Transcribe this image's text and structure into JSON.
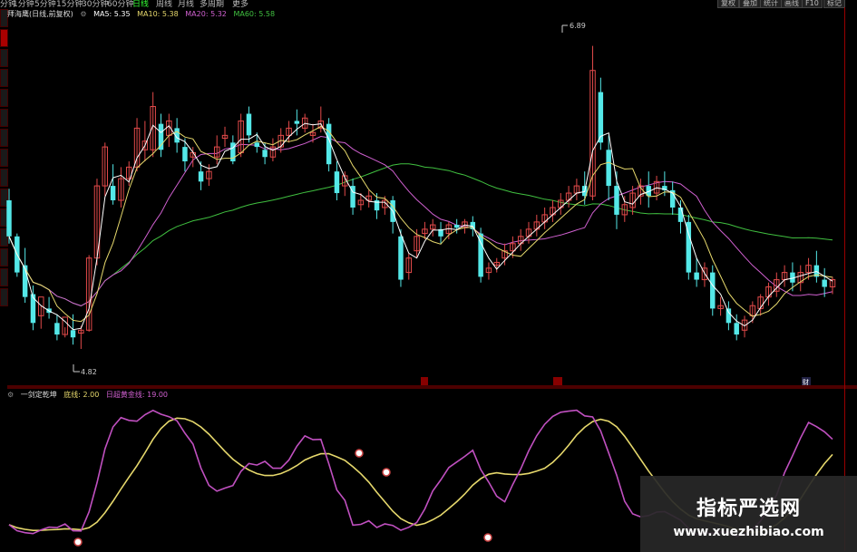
{
  "toolbar": {
    "periods": [
      "分钟",
      "1分钟",
      "5分钟",
      "15分钟",
      "30分钟",
      "60分钟",
      "日线",
      "周线",
      "月线",
      "多周期",
      "更多"
    ],
    "active_period": "日线",
    "right_buttons": [
      "复权",
      "叠加",
      "统计",
      "画线",
      "F10",
      "标记"
    ]
  },
  "main_legend": {
    "stock": "拜海鹰(日线,前复权)",
    "ma5": "MA5: 5.35",
    "ma10": "MA10: 5.38",
    "ma20": "MA20: 5.32",
    "ma60": "MA60: 5.58",
    "colors": {
      "ma5": "#ffffff",
      "ma10": "#e6d86c",
      "ma20": "#d060d0",
      "ma60": "#40c040"
    }
  },
  "sub_legend": {
    "indicator": "一剑定乾坤",
    "param1": "底线: 2.00",
    "param2": "日超黄金线: 19.00"
  },
  "annotations": {
    "high_label": "6.89",
    "low_label": "4.82",
    "marker_a": "",
    "marker_b": "",
    "marker_c": "财"
  },
  "watermark": {
    "title": "指标严选网",
    "url": "www.xuezhibiao.com"
  },
  "chart_data": {
    "type": "candlestick",
    "price_range": [
      4.6,
      7.1
    ],
    "candles": [
      [
        5.85,
        5.93,
        5.6,
        5.55
      ],
      [
        5.6,
        5.62,
        5.35,
        5.32
      ],
      [
        5.4,
        5.52,
        5.18,
        5.14
      ],
      [
        5.2,
        5.26,
        5.0,
        4.95
      ],
      [
        5.05,
        5.12,
        5.18,
        4.96
      ],
      [
        5.1,
        5.18,
        5.07,
        5.03
      ],
      [
        5.0,
        5.06,
        4.92,
        4.88
      ],
      [
        4.92,
        4.97,
        5.04,
        4.9
      ],
      [
        4.95,
        5.06,
        4.9,
        4.85
      ],
      [
        4.93,
        4.98,
        4.95,
        4.82
      ],
      [
        4.95,
        5.47,
        5.45,
        4.94
      ],
      [
        5.45,
        6.0,
        5.95,
        5.4
      ],
      [
        5.95,
        6.25,
        6.22,
        5.88
      ],
      [
        5.95,
        6.1,
        5.85,
        5.82
      ],
      [
        5.85,
        6.08,
        6.0,
        5.8
      ],
      [
        6.0,
        6.12,
        6.08,
        5.95
      ],
      [
        6.08,
        6.42,
        6.35,
        6.05
      ],
      [
        6.2,
        6.4,
        6.26,
        6.12
      ],
      [
        6.2,
        6.6,
        6.5,
        6.15
      ],
      [
        6.38,
        6.45,
        6.2,
        6.15
      ],
      [
        6.3,
        6.45,
        6.4,
        6.22
      ],
      [
        6.35,
        6.42,
        6.25,
        6.18
      ],
      [
        6.22,
        6.28,
        6.12,
        6.05
      ],
      [
        6.15,
        6.22,
        6.18,
        6.08
      ],
      [
        6.05,
        6.12,
        5.98,
        5.92
      ],
      [
        6.0,
        6.1,
        6.05,
        5.95
      ],
      [
        6.15,
        6.3,
        6.22,
        6.1
      ],
      [
        6.28,
        6.36,
        6.3,
        6.22
      ],
      [
        6.25,
        6.3,
        6.12,
        6.1
      ],
      [
        6.18,
        6.45,
        6.4,
        6.15
      ],
      [
        6.45,
        6.5,
        6.3,
        6.25
      ],
      [
        6.25,
        6.32,
        6.22,
        6.18
      ],
      [
        6.2,
        6.25,
        6.15,
        6.1
      ],
      [
        6.15,
        6.28,
        6.22,
        6.12
      ],
      [
        6.22,
        6.35,
        6.3,
        6.18
      ],
      [
        6.3,
        6.4,
        6.35,
        6.25
      ],
      [
        6.4,
        6.48,
        6.38,
        6.3
      ],
      [
        6.35,
        6.45,
        6.42,
        6.32
      ],
      [
        6.3,
        6.38,
        6.32,
        6.25
      ],
      [
        6.35,
        6.5,
        6.4,
        6.32
      ],
      [
        6.38,
        6.42,
        6.1,
        6.05
      ],
      [
        6.05,
        6.12,
        5.9,
        5.85
      ],
      [
        5.95,
        6.05,
        6.02,
        5.88
      ],
      [
        5.95,
        6.0,
        5.8,
        5.75
      ],
      [
        5.82,
        5.9,
        5.85,
        5.78
      ],
      [
        5.85,
        5.92,
        5.88,
        5.8
      ],
      [
        5.85,
        5.9,
        5.78,
        5.72
      ],
      [
        5.8,
        5.88,
        5.85,
        5.75
      ],
      [
        5.85,
        5.88,
        5.7,
        5.62
      ],
      [
        5.6,
        5.65,
        5.3,
        5.25
      ],
      [
        5.35,
        5.48,
        5.45,
        5.3
      ],
      [
        5.5,
        5.65,
        5.6,
        5.45
      ],
      [
        5.62,
        5.7,
        5.65,
        5.58
      ],
      [
        5.65,
        5.72,
        5.68,
        5.6
      ],
      [
        5.65,
        5.7,
        5.6,
        5.55
      ],
      [
        5.62,
        5.7,
        5.68,
        5.58
      ],
      [
        5.68,
        5.72,
        5.66,
        5.62
      ],
      [
        5.66,
        5.72,
        5.7,
        5.62
      ],
      [
        5.7,
        5.74,
        5.65,
        5.6
      ],
      [
        5.62,
        5.66,
        5.32,
        5.28
      ],
      [
        5.35,
        5.42,
        5.38,
        5.3
      ],
      [
        5.4,
        5.45,
        5.42,
        5.35
      ],
      [
        5.45,
        5.55,
        5.5,
        5.4
      ],
      [
        5.5,
        5.6,
        5.55,
        5.45
      ],
      [
        5.55,
        5.65,
        5.6,
        5.5
      ],
      [
        5.6,
        5.7,
        5.65,
        5.55
      ],
      [
        5.65,
        5.75,
        5.7,
        5.6
      ],
      [
        5.7,
        5.8,
        5.75,
        5.65
      ],
      [
        5.75,
        5.85,
        5.8,
        5.7
      ],
      [
        5.8,
        5.9,
        5.85,
        5.75
      ],
      [
        5.85,
        5.95,
        5.9,
        5.8
      ],
      [
        5.9,
        6.0,
        5.95,
        5.85
      ],
      [
        5.95,
        6.05,
        5.88,
        5.82
      ],
      [
        5.88,
        6.92,
        6.75,
        5.85
      ],
      [
        6.6,
        6.7,
        6.25,
        6.2
      ],
      [
        6.2,
        6.3,
        5.95,
        5.85
      ],
      [
        5.95,
        6.05,
        5.75,
        5.65
      ],
      [
        5.75,
        5.88,
        5.82,
        5.7
      ],
      [
        5.8,
        5.95,
        5.9,
        5.75
      ],
      [
        5.88,
        6.0,
        5.95,
        5.82
      ],
      [
        5.95,
        6.05,
        5.88,
        5.8
      ],
      [
        5.9,
        6.02,
        5.98,
        5.85
      ],
      [
        5.95,
        6.05,
        5.92,
        5.88
      ],
      [
        5.92,
        5.98,
        5.8,
        5.75
      ],
      [
        5.8,
        5.85,
        5.7,
        5.62
      ],
      [
        5.7,
        5.75,
        5.35,
        5.3
      ],
      [
        5.35,
        5.45,
        5.3,
        5.25
      ],
      [
        5.3,
        5.42,
        5.38,
        5.25
      ],
      [
        5.35,
        5.4,
        5.1,
        5.05
      ],
      [
        5.1,
        5.18,
        5.12,
        5.05
      ],
      [
        5.1,
        5.15,
        5.0,
        4.95
      ],
      [
        5.0,
        5.06,
        4.92,
        4.88
      ],
      [
        4.95,
        5.05,
        5.02,
        4.9
      ],
      [
        5.05,
        5.15,
        5.12,
        5.0
      ],
      [
        5.1,
        5.2,
        5.18,
        5.05
      ],
      [
        5.18,
        5.28,
        5.25,
        5.12
      ],
      [
        5.22,
        5.35,
        5.3,
        5.18
      ],
      [
        5.3,
        5.4,
        5.35,
        5.25
      ],
      [
        5.35,
        5.42,
        5.28,
        5.22
      ],
      [
        5.28,
        5.4,
        5.35,
        5.22
      ],
      [
        5.35,
        5.45,
        5.4,
        5.3
      ],
      [
        5.4,
        5.5,
        5.32,
        5.28
      ],
      [
        5.3,
        5.38,
        5.25,
        5.18
      ],
      [
        5.25,
        5.32,
        5.3,
        5.2
      ]
    ]
  }
}
